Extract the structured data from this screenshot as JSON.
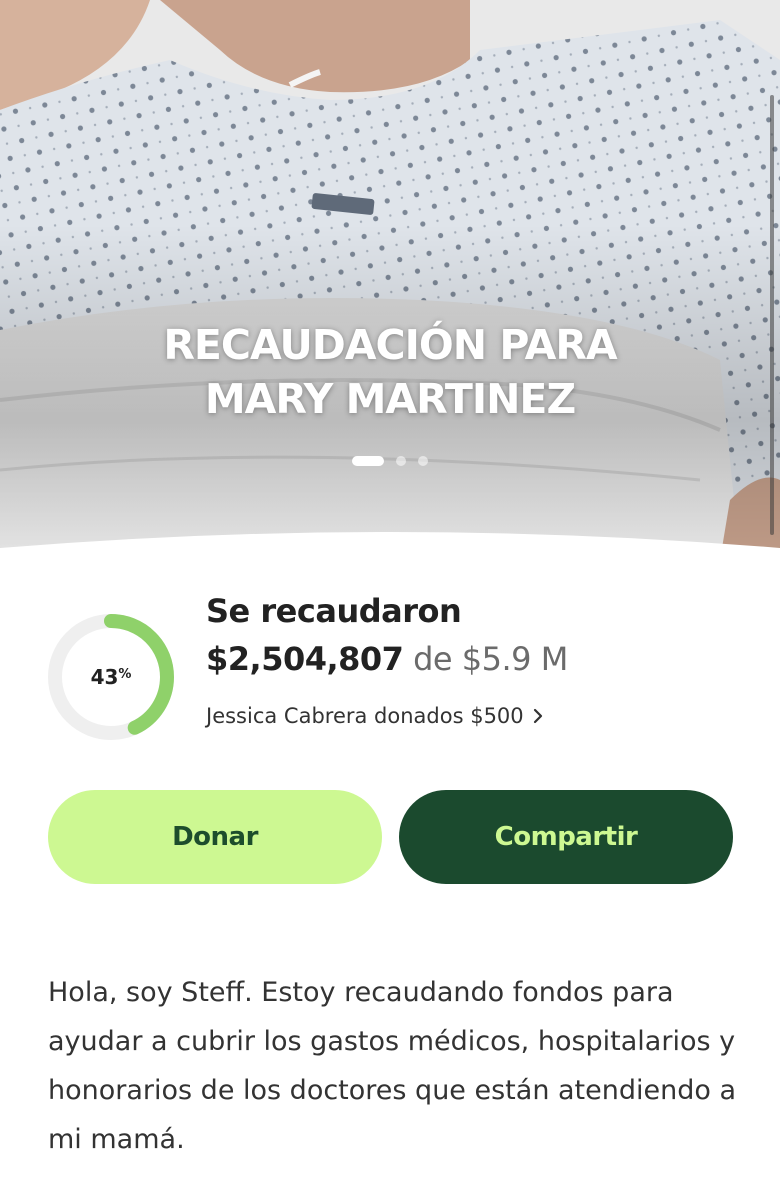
{
  "hero": {
    "title_line1": "RECAUDACIÓN PARA",
    "title_line2": "MARY MARTINEZ",
    "carousel": {
      "total": 3,
      "active": 1
    }
  },
  "progress": {
    "percent": 43,
    "percent_label": "43",
    "percent_sign": "%",
    "raised_title": "Se recaudaron",
    "raised_amount": "$2,504,807",
    "goal_text": "de $5.9 M",
    "recent_donation": "Jessica Cabrera donados $500"
  },
  "buttons": {
    "donate_label": "Donar",
    "share_label": "Compartir"
  },
  "description": "Hola, soy Steff. Estoy recaudando fondos para ayudar a cubrir los gastos médicos, hospitalarios y honorarios de los doctores que están atendiendo a mi mamá.",
  "colors": {
    "accent_light": "#cdf892",
    "accent_dark": "#1b4a2e",
    "ring_fill": "#8fd16a",
    "ring_track": "#efefef"
  }
}
